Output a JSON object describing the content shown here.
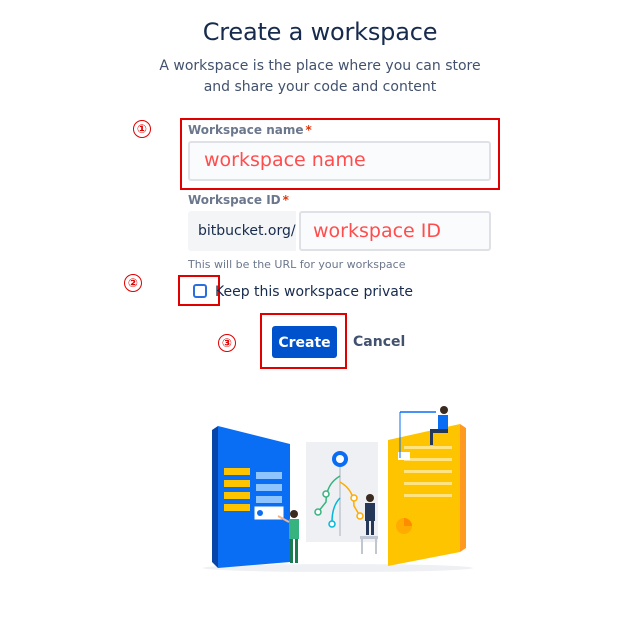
{
  "header": {
    "title": "Create a workspace",
    "subtitle_line1": "A workspace is the place where you can store",
    "subtitle_line2": "and share your code and content"
  },
  "form": {
    "workspace_name": {
      "label": "Workspace name",
      "required_marker": "*",
      "value": "workspace name"
    },
    "workspace_id": {
      "label": "Workspace ID",
      "required_marker": "*",
      "prefix": "bitbucket.org/",
      "value": "workspace ID",
      "helper": "This will be the URL for your workspace"
    },
    "private_checkbox": {
      "label": "Keep this workspace private",
      "checked": false
    },
    "create_label": "Create",
    "cancel_label": "Cancel"
  },
  "annotations": {
    "step1": "①",
    "step2": "②",
    "step3": "③",
    "color": "#e00000"
  },
  "colors": {
    "primary_button": "#0052cc",
    "heading": "#172b4d",
    "muted": "#6b778c",
    "required": "#de350b"
  }
}
